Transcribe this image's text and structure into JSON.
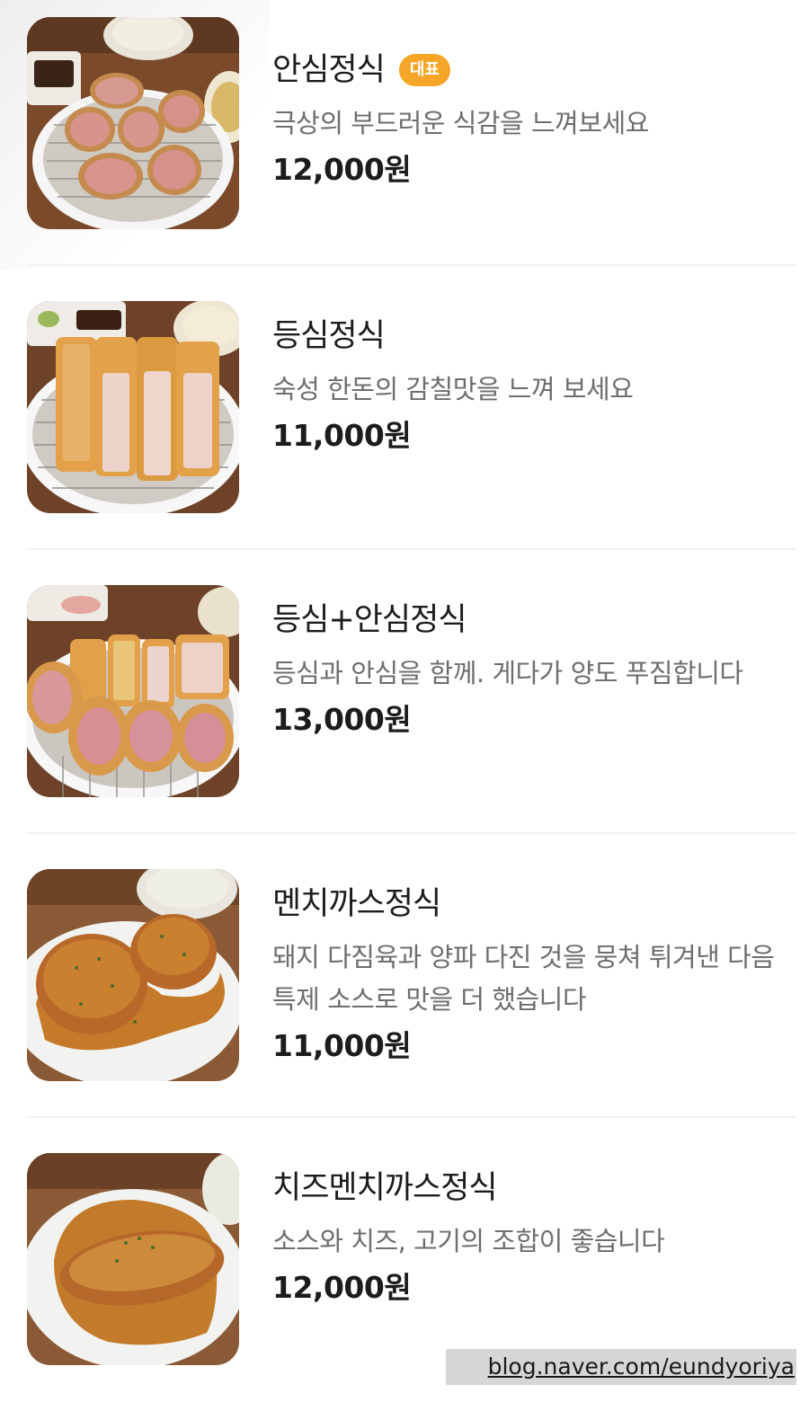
{
  "menu": {
    "items": [
      {
        "name": "안심정식",
        "badge": "대표",
        "description": "극상의 부드러운 식감을 느껴보세요",
        "price": "12,000원",
        "photo": "pork-tenderloin-slices-photo"
      },
      {
        "name": "등심정식",
        "badge": "",
        "description": "숙성 한돈의 감칠맛을 느껴 보세요",
        "price": "11,000원",
        "photo": "pork-loin-cutlet-photo"
      },
      {
        "name": "등심+안심정식",
        "badge": "",
        "description": "등심과 안심을 함께. 게다가 양도 푸짐합니다",
        "price": "13,000원",
        "photo": "mixed-cutlet-photo"
      },
      {
        "name": "멘치까스정식",
        "badge": "",
        "description": "돼지 다짐육과 양파 다진 것을 뭉쳐 튀겨낸 다음 특제 소스로 맛을 더 했습니다",
        "price": "11,000원",
        "photo": "menchi-katsu-photo"
      },
      {
        "name": "치즈멘치까스정식",
        "badge": "",
        "description": "소스와 치즈, 고기의 조합이 좋습니다",
        "price": "12,000원",
        "photo": "cheese-menchi-katsu-photo"
      }
    ]
  },
  "watermark": "blog.naver.com/eundyoriya",
  "colors": {
    "badge": "#f5a628",
    "name_text": "#1c1c1c",
    "desc_text": "#6e6e6e"
  }
}
